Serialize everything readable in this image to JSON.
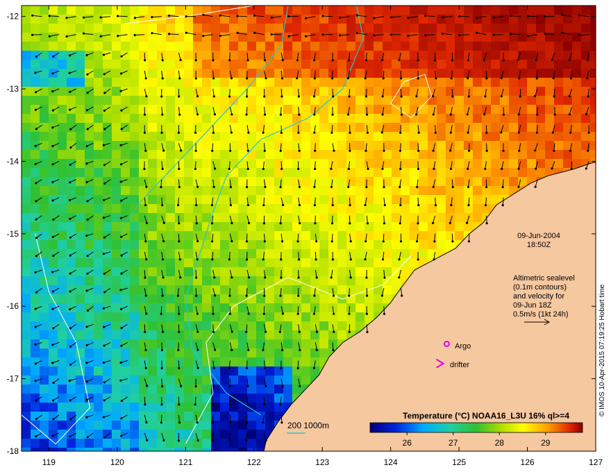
{
  "map": {
    "lon_range": [
      118.6,
      127.0
    ],
    "lat_range": [
      -18.0,
      -11.85
    ],
    "x_ticks": [
      "119",
      "120",
      "121",
      "122",
      "123",
      "124",
      "125",
      "126",
      "127"
    ],
    "y_ticks": [
      "-12",
      "-13",
      "-14",
      "-15",
      "-16",
      "-17",
      "-18"
    ],
    "land_color": "#f6c8a0",
    "coast_color": "#000000",
    "isobath_color": "#29c4d0",
    "sealevel_contour_color": "#ffffff"
  },
  "annotations": {
    "date": "09-Jun-2004",
    "time": "18:50Z",
    "legend_lines": [
      "Altimetric sealevel",
      "(0.1m contours)",
      "and velocity for",
      "09-Jun 18Z",
      "0.5m/s (1kt 24h)"
    ],
    "argo_label": "Argo",
    "drifter_label": "drifter",
    "isobath_label": "200  1000m",
    "credit": "© IMOS 10-Apr-2015 07:19:25 Hobart time"
  },
  "colorbar": {
    "title": "Temperature (°C) NOAA16_L3U 16% ql>=4",
    "range": [
      25.2,
      29.8
    ],
    "ticks": [
      "26",
      "27",
      "28",
      "29"
    ]
  },
  "markers": {
    "argo": {
      "lon": 124.82,
      "lat": -16.52,
      "color": "#e000e0"
    },
    "drifter": {
      "lon": 124.72,
      "lat": -16.79,
      "color": "#e000e0"
    }
  }
}
